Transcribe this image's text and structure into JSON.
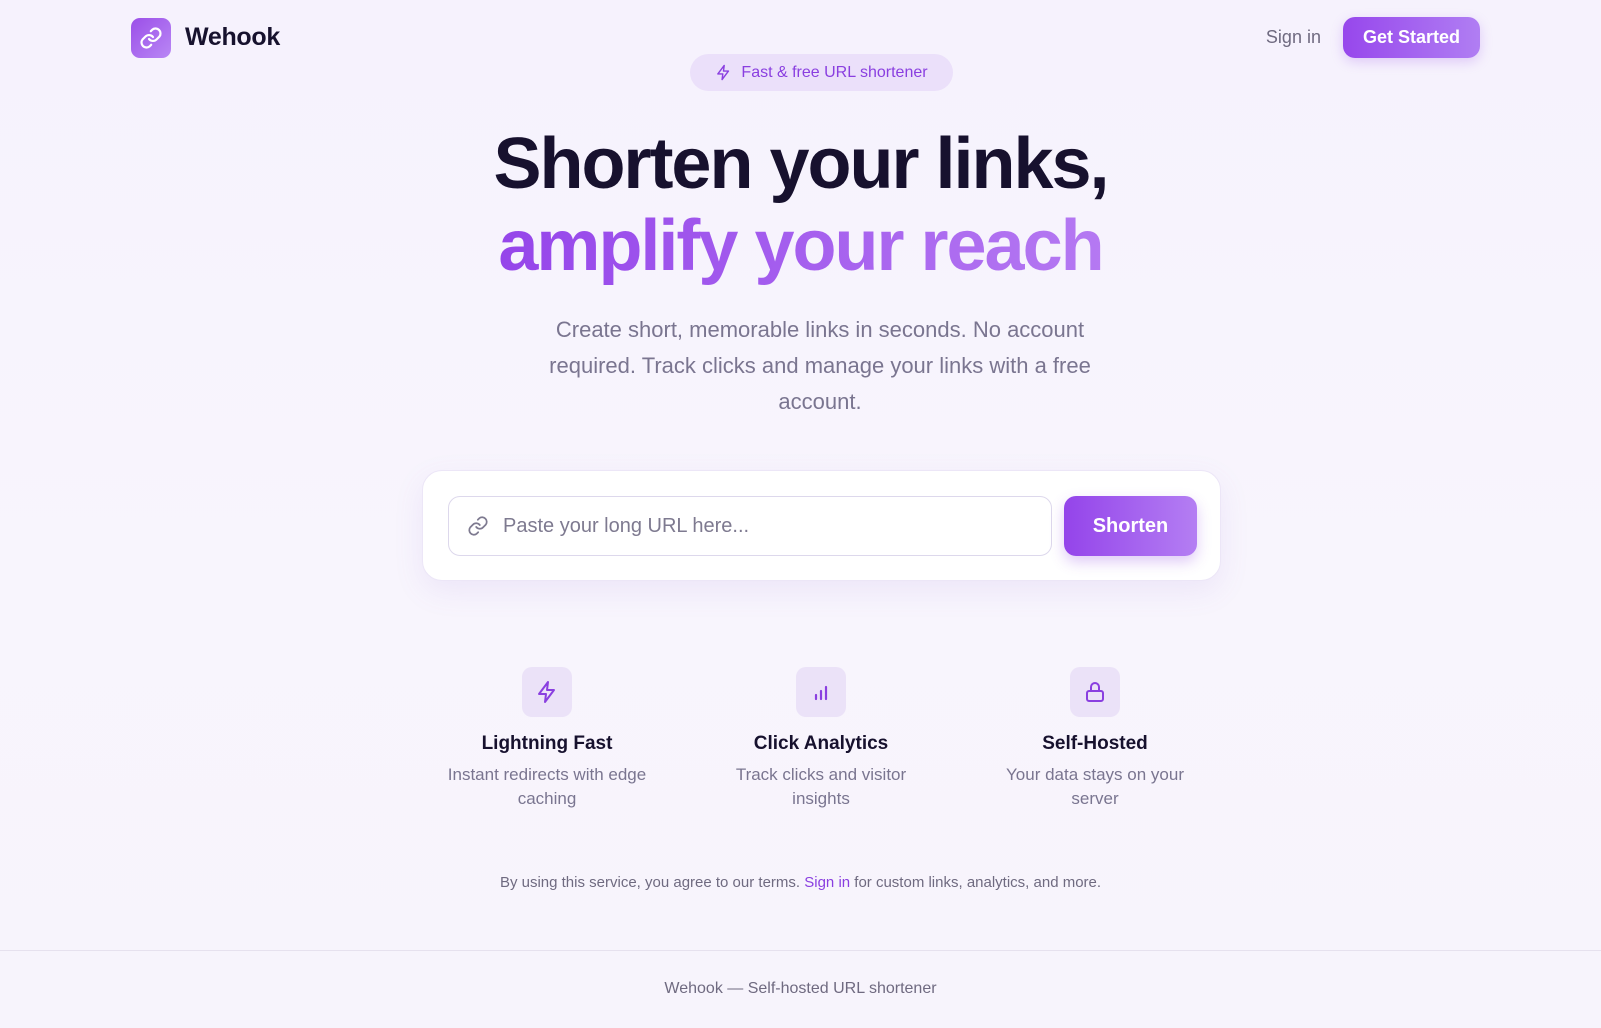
{
  "header": {
    "brand": "Wehook",
    "signin": "Sign in",
    "get_started": "Get Started"
  },
  "badge": {
    "label": "Fast & free URL shortener"
  },
  "hero": {
    "line1": "Shorten your links,",
    "line2": "amplify your reach",
    "subtitle": "Create short, memorable links in seconds. No account required. Track clicks and manage your links with a free account."
  },
  "shortener": {
    "placeholder": "Paste your long URL here...",
    "button": "Shorten"
  },
  "features": [
    {
      "icon": "lightning-icon",
      "title": "Lightning Fast",
      "desc": "Instant redirects with edge caching"
    },
    {
      "icon": "bar-chart-icon",
      "title": "Click Analytics",
      "desc": "Track clicks and visitor insights"
    },
    {
      "icon": "lock-icon",
      "title": "Self-Hosted",
      "desc": "Your data stays on your server"
    }
  ],
  "terms": {
    "before": "By using this service, you agree to our terms. ",
    "link": "Sign in",
    "after": " for custom links, analytics, and more."
  },
  "footer": {
    "text": "Wehook — Self-hosted URL shortener"
  },
  "colors": {
    "accent": "#9747ec",
    "accent_light": "#b47ef3",
    "text": "#17112e",
    "muted": "#7a7590"
  }
}
